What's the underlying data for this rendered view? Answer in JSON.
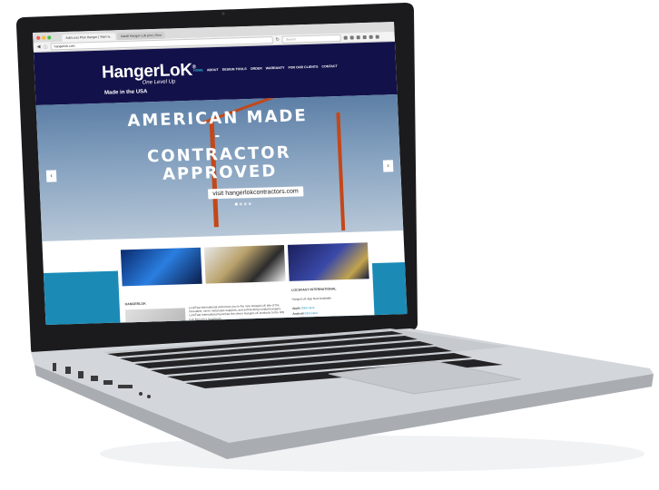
{
  "browser": {
    "tabs": [
      {
        "label": "Add Less Plan Hanger | Start w.."
      },
      {
        "label": "Install Hanger-Lok pinz | Bon"
      }
    ],
    "url": "hangerlok.com",
    "search_placeholder": "Search"
  },
  "site": {
    "brand": "HangerLoK",
    "brand_mark": "®",
    "tagline": "One Level Up",
    "made_in": "Made in the USA",
    "menu": [
      {
        "label": "HOME",
        "active": true
      },
      {
        "label": "ABOUT",
        "active": false
      },
      {
        "label": "DESIGN TOOLS",
        "active": false
      },
      {
        "label": "ORDER",
        "active": false
      },
      {
        "label": "WARRANTY",
        "active": false
      },
      {
        "label": "FOR OUR CLIENTS",
        "active": false
      },
      {
        "label": "CONTACT",
        "active": false
      }
    ]
  },
  "hero": {
    "line1": "AMERICAN MADE",
    "line2": "-",
    "line3": "CONTRACTOR",
    "line4": "APPROVED",
    "cta": "visit hangerlokcontractors.com",
    "prev_arrow": "‹",
    "next_arrow": "›"
  },
  "sections": {
    "left_heading": "HANGERLOK",
    "left_text": "LockFast International welcomes you to the new HangerLoK site of the innovative, set-in metal pipe supports, and self-leveling conduit hangers. LockFast International launches the clever HangerLoK products to the HW hub through a local team.",
    "right_heading": "LOCKFAST INTERNATIONAL",
    "right_text": "HangerLoK App Now Available",
    "right_link1_label": "Apple",
    "right_link1": "Click Here",
    "right_link2_label": "Android",
    "right_link2": "Click Here"
  },
  "colors": {
    "header_bg": "#13114a",
    "accent": "#2fb8d6",
    "band": "#1b8bb6",
    "crane": "#c44718"
  }
}
